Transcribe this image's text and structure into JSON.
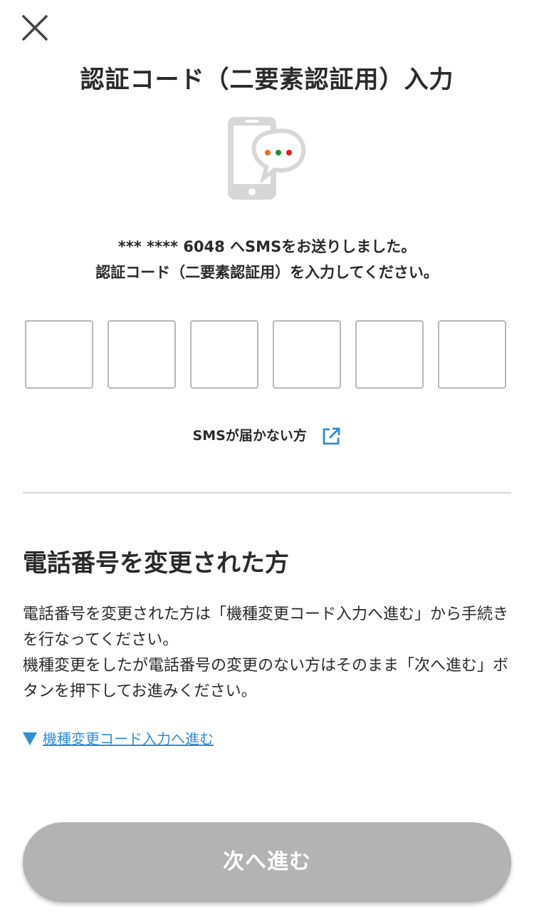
{
  "header": {
    "close_icon": "close-icon",
    "title": "認証コード（二要素認証用）入力"
  },
  "illustration": {
    "icon": "phone-sms-icon",
    "dot_colors": [
      "#e8731a",
      "#1e8f3a",
      "#d9231c"
    ]
  },
  "instruction": {
    "line1": "*** **** 6048 へSMSをお送りしました。",
    "line2": "認証コード（二要素認証用）を入力してください。"
  },
  "code_inputs": [
    "",
    "",
    "",
    "",
    "",
    ""
  ],
  "sms_help": {
    "label": "SMSが届かない方",
    "icon": "external-link-icon"
  },
  "phone_change": {
    "heading": "電話番号を変更された方",
    "paragraph1": "電話番号を変更された方は「機種変更コード入力へ進む」から手続きを行なってください。",
    "paragraph2": "機種変更をしたが電話番号の変更のない方はそのまま「次へ進む」ボタンを押下してお進みください。",
    "link_label": "機種変更コード入力へ進む"
  },
  "footer": {
    "next_label": "次へ進む"
  },
  "colors": {
    "accent": "#2f8dd8",
    "button_disabled": "#b3b3b3",
    "text": "#2a2a2a"
  }
}
